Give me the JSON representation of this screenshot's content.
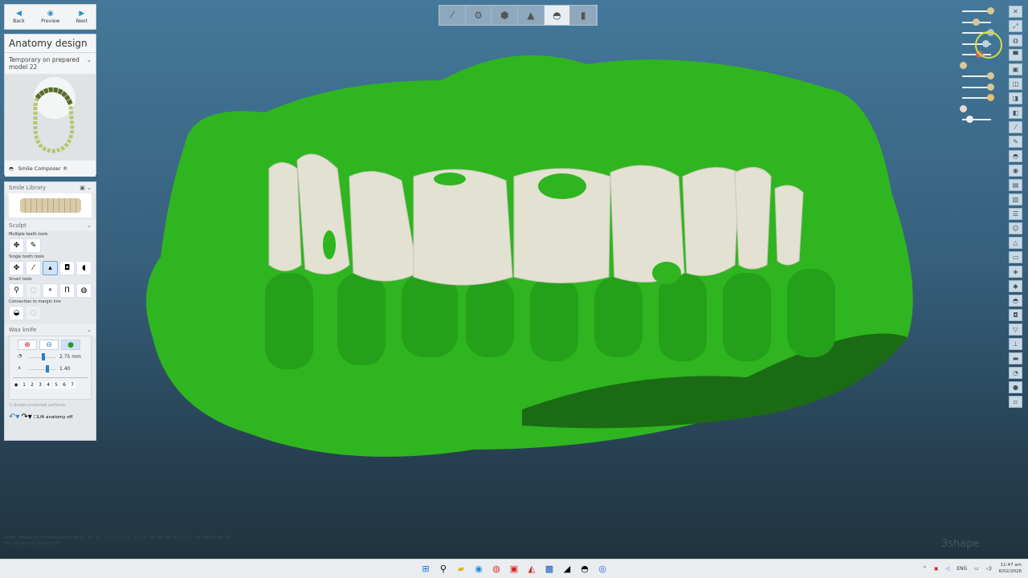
{
  "nav": {
    "back": "Back",
    "preview": "Preview",
    "next": "Next"
  },
  "anatomy": {
    "title": "Anatomy design",
    "selection": "Temporary on prepared model 22",
    "composer": "Smile Composer ®"
  },
  "smile_library": {
    "title": "Smile Library"
  },
  "sculpt": {
    "title": "Sculpt",
    "multiple": "Multiple teeth tools",
    "single": "Single tooth tools",
    "smart": "Smart tools",
    "margin": "Connection to margin line"
  },
  "wax_knife": {
    "title": "Wax knife",
    "size": "2.75 mm",
    "size_level": 0.5,
    "strength": "1.40",
    "strength_level": 0.6,
    "levels": [
      "1",
      "2",
      "3",
      "4",
      "5",
      "6",
      "7"
    ],
    "protect": "Sculpt protected surfaces",
    "lift": "Lift anatomy off"
  },
  "status": {
    "order_label": "Order:",
    "order": "Temporary on prepared model 21, 14, 13, 12, 11, 21, 22, 23, 24, 25, 26, 36, 35, 33, 31, 41, 42, 43, 44, 45",
    "file_label": "File:",
    "file": "Advanced Ceramics Inc"
  },
  "brand": "3shape",
  "tray": {
    "lang": "ENG",
    "time": "11:47 am",
    "date": "6/02/2026"
  },
  "colors": {
    "model": "#2fbf1f",
    "teeth": "#e6e4d6",
    "accent": "#2a8fc6"
  }
}
